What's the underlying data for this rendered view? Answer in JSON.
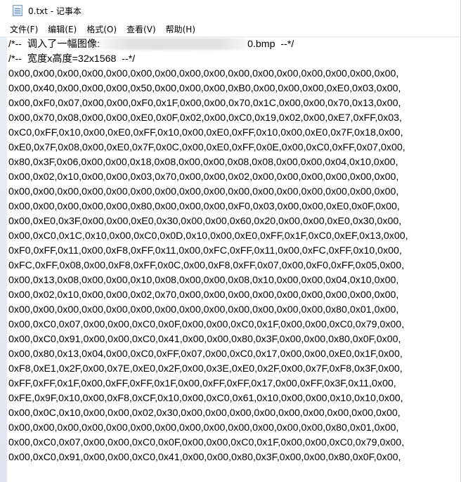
{
  "window": {
    "title": "0.txt - 记事本",
    "icon": "notepad-icon"
  },
  "menu": [
    {
      "label": "文件(F)"
    },
    {
      "label": "编辑(E)"
    },
    {
      "label": "格式(O)"
    },
    {
      "label": "查看(V)"
    },
    {
      "label": "帮助(H)"
    }
  ],
  "editor": {
    "header_line_1_prefix": "/*--  调入了一幅图像:",
    "header_line_1_suffix": "0.bmp  --*/",
    "header_line_2": "/*--  宽度x高度=32x1568  --*/",
    "hex_lines": [
      "0x00,0x00,0x00,0x00,0x00,0x00,0x00,0x00,0x00,0x00,0x00,0x00,0x00,0x00,0x00,0x00,",
      "0x00,0x40,0x00,0x00,0x00,0x50,0x00,0x00,0x00,0xB0,0x00,0x00,0x00,0xE0,0x03,0x00,",
      "0x00,0xF0,0x07,0x00,0x00,0xF0,0x1F,0x00,0x00,0x70,0x1C,0x00,0x00,0x70,0x13,0x00,",
      "0x00,0x70,0x08,0x00,0x00,0xE0,0x0F,0x02,0x00,0xC0,0x19,0x02,0x00,0xE7,0xFF,0x03,",
      "0xC0,0xFF,0x10,0x00,0xE0,0xFF,0x10,0x00,0xE0,0xFF,0x10,0x00,0xE0,0x7F,0x18,0x00,",
      "0xE0,0x7F,0x08,0x00,0xE0,0x7F,0x0C,0x00,0xE0,0xFF,0x0E,0x00,0xC0,0xFF,0x07,0x00,",
      "0x80,0x3F,0x06,0x00,0x00,0x18,0x08,0x00,0x00,0x08,0x08,0x00,0x00,0x04,0x10,0x00,",
      "0x00,0x02,0x10,0x00,0x00,0x03,0x70,0x00,0x00,0x02,0x00,0x00,0x00,0x00,0x00,0x00,",
      "0x00,0x00,0x00,0x00,0x00,0x00,0x00,0x00,0x00,0x00,0x00,0x00,0x00,0x00,0x00,0x00,",
      "0x00,0x00,0x00,0x00,0x00,0x80,0x00,0x00,0x00,0xF0,0x03,0x00,0x00,0xE0,0x0F,0x00,",
      "0x00,0xE0,0x3F,0x00,0x00,0xE0,0x30,0x00,0x00,0x60,0x20,0x00,0x00,0xE0,0x30,0x00,",
      "0x00,0xC0,0x1C,0x10,0x00,0xC0,0x0D,0x10,0x00,0xE0,0xFF,0x1F,0xC0,0xEF,0x13,0x00,",
      "0xF0,0xFF,0x11,0x00,0xF8,0xFF,0x11,0x00,0xFC,0xFF,0x11,0x00,0xFC,0xFF,0x10,0x00,",
      "0xFC,0xFF,0x08,0x00,0xF8,0xFF,0x0C,0x00,0xF8,0xFF,0x07,0x00,0xF0,0xFF,0x05,0x00,",
      "0x00,0x13,0x08,0x00,0x00,0x10,0x08,0x00,0x00,0x08,0x10,0x00,0x00,0x04,0x10,0x00,",
      "0x00,0x02,0x10,0x00,0x00,0x02,0x70,0x00,0x00,0x00,0x00,0x00,0x00,0x00,0x00,0x00,",
      "0x00,0x00,0x00,0x00,0x00,0x00,0x00,0x00,0x00,0x00,0x00,0x00,0x00,0x80,0x01,0x00,",
      "0x00,0xC0,0x07,0x00,0x00,0xC0,0x0F,0x00,0x00,0xC0,0x1F,0x00,0x00,0xC0,0x79,0x00,",
      "0x00,0xC0,0x91,0x00,0x00,0xC0,0x41,0x00,0x00,0x80,0x3F,0x00,0x00,0x80,0x0F,0x00,",
      "0x00,0x80,0x13,0x04,0x00,0xC0,0xFF,0x07,0x00,0xC0,0x17,0x00,0x00,0xE0,0x1F,0x00,",
      "0xF8,0xE1,0x2F,0x00,0x7E,0xE0,0x2F,0x00,0x3E,0xE0,0x2F,0x00,0x7F,0xF8,0x3F,0x00,",
      "0xFF,0xFF,0x1F,0x00,0xFF,0xFF,0x1F,0x00,0xFF,0xFF,0x17,0x00,0xFF,0x3F,0x11,0x00,",
      "0xFE,0x9F,0x10,0x00,0xF8,0xCF,0x10,0x00,0xC0,0x61,0x10,0x00,0x00,0x10,0x10,0x00,",
      "0x00,0x0C,0x10,0x00,0x00,0x02,0x30,0x00,0x00,0x00,0x00,0x00,0x00,0x00,0x00,0x00,",
      "0x00,0x00,0x00,0x00,0x00,0x00,0x00,0x00,0x00,0x00,0x00,0x00,0x00,0x80,0x01,0x00,",
      "0x00,0xC0,0x07,0x00,0x00,0xC0,0x0F,0x00,0x00,0xC0,0x1F,0x00,0x00,0xC0,0x79,0x00,",
      "0x00,0xC0,0x91,0x00,0x00,0xC0,0x41,0x00,0x00,0x80,0x3F,0x00,0x00,0x80,0x0F,0x00,"
    ]
  }
}
